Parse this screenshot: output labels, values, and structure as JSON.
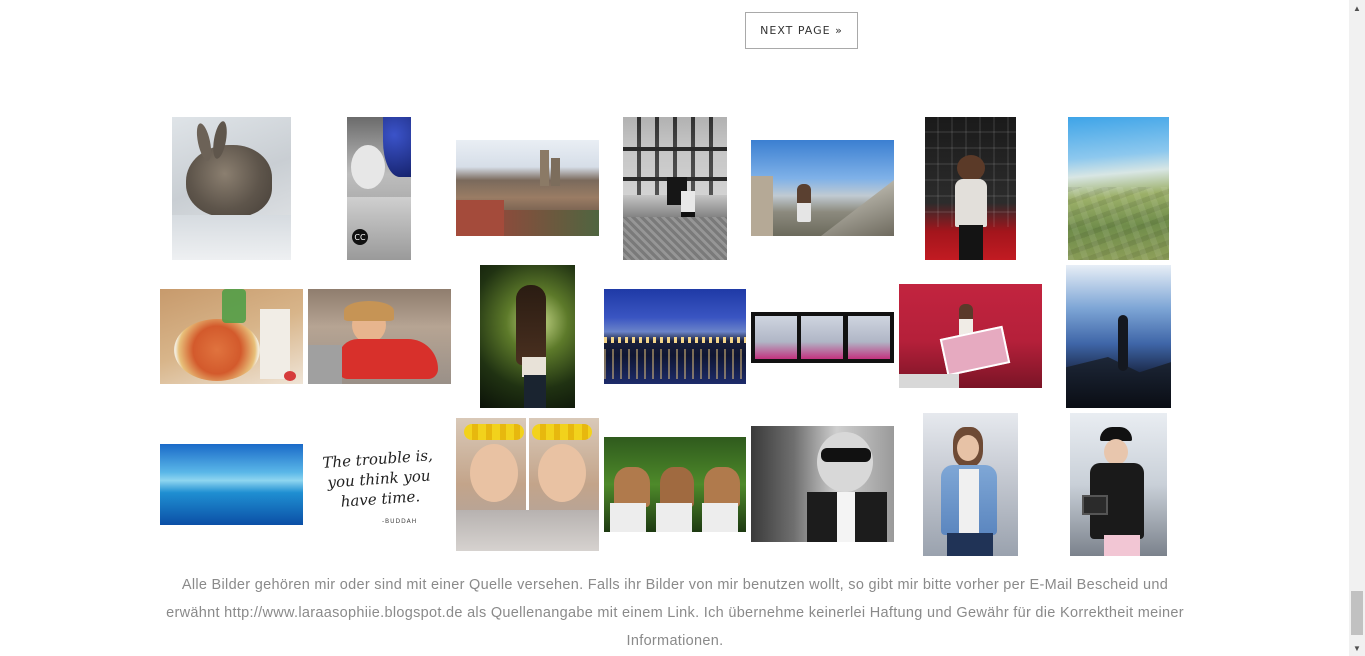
{
  "pagination": {
    "next_label": "NEXT PAGE »"
  },
  "gallery": [
    {
      "name": "rabbit-photo"
    },
    {
      "name": "selfie-chanel-photo"
    },
    {
      "name": "city-view-photo"
    },
    {
      "name": "timber-house-photo"
    },
    {
      "name": "mountain-view-photo"
    },
    {
      "name": "event-wall-photo"
    },
    {
      "name": "aerial-fields-photo"
    },
    {
      "name": "pizza-photo"
    },
    {
      "name": "kid-red-shirt-photo"
    },
    {
      "name": "forest-hair-photo"
    },
    {
      "name": "night-waterfront-photo"
    },
    {
      "name": "nyx-event-strip-photo"
    },
    {
      "name": "glow-event-photo"
    },
    {
      "name": "sea-rocks-photo"
    },
    {
      "name": "underwater-sea-photo"
    },
    {
      "name": "quote-card"
    },
    {
      "name": "flower-crown-selfie-photo"
    },
    {
      "name": "hair-flip-triple-photo"
    },
    {
      "name": "karl-lagerfeld-photo"
    },
    {
      "name": "denim-jacket-photo"
    },
    {
      "name": "cap-camera-photo"
    }
  ],
  "quote": {
    "text": "The trouble is, you think you have time.",
    "signature": "-BUDDAH"
  },
  "chanel_logo": "CC",
  "footer": {
    "text": "Alle Bilder gehören mir oder sind mit einer Quelle versehen. Falls ihr Bilder von mir benutzen wollt, so gibt mir bitte vorher per E-Mail Bescheid und erwähnt http://www.laraasophiie.blogspot.de als Quellenangabe mit einem Link. Ich übernehme keinerlei Haftung und Gewähr für die Korrektheit meiner Informationen."
  },
  "colors": {
    "footer_text": "#8a8a8a",
    "button_border": "#a9a9a9"
  }
}
